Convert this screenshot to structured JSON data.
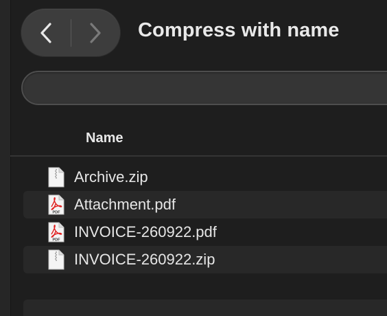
{
  "dialog": {
    "title": "Compress with name",
    "name_field": {
      "value": "",
      "placeholder": ""
    }
  },
  "navigation": {
    "back_icon": "chevron-left-icon",
    "forward_icon": "chevron-right-icon"
  },
  "table": {
    "column_header": "Name",
    "files": [
      {
        "name": "Archive.zip",
        "icon": "zip-document-icon"
      },
      {
        "name": "Attachment.pdf",
        "icon": "pdf-document-icon"
      },
      {
        "name": "INVOICE-260922.pdf",
        "icon": "pdf-document-icon"
      },
      {
        "name": "INVOICE-260922.zip",
        "icon": "zip-document-icon"
      }
    ]
  },
  "colors": {
    "background": "#1e1e1e",
    "pdf_red": "#e0201f",
    "text": "#e6e6e6"
  }
}
